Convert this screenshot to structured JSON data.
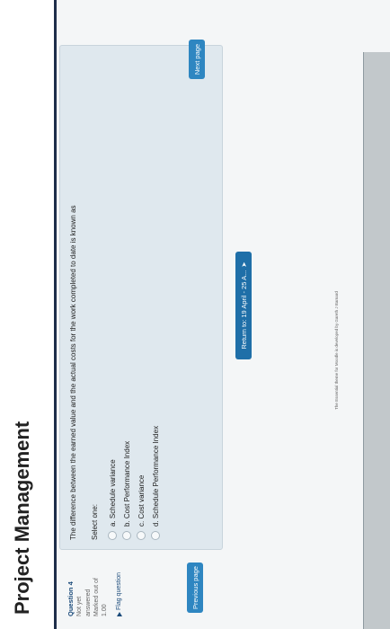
{
  "header": {
    "title": "Project Management"
  },
  "question": {
    "number_label": "Question 4",
    "state_lines": [
      "Not yet",
      "answered"
    ],
    "marks_lines": [
      "Marked out of",
      "1.00"
    ],
    "flag_label": "Flag question",
    "text": "The difference between the earned value and the actual costs for the work completed to date is known as",
    "select_label": "Select one:",
    "options": [
      "a. Schedule variance",
      "b. Cost Performance Index",
      "c. Cost variance",
      "d. Schedule Performance Index"
    ]
  },
  "navigation": {
    "previous_label": "Previous page",
    "next_label": "Next page",
    "return_label": "Return to: 19 April - 25 A...",
    "return_icon": "arrow-right-icon"
  },
  "footer": {
    "credit": "The Essential theme for Moodle is developed by Gareth J Barnard"
  }
}
